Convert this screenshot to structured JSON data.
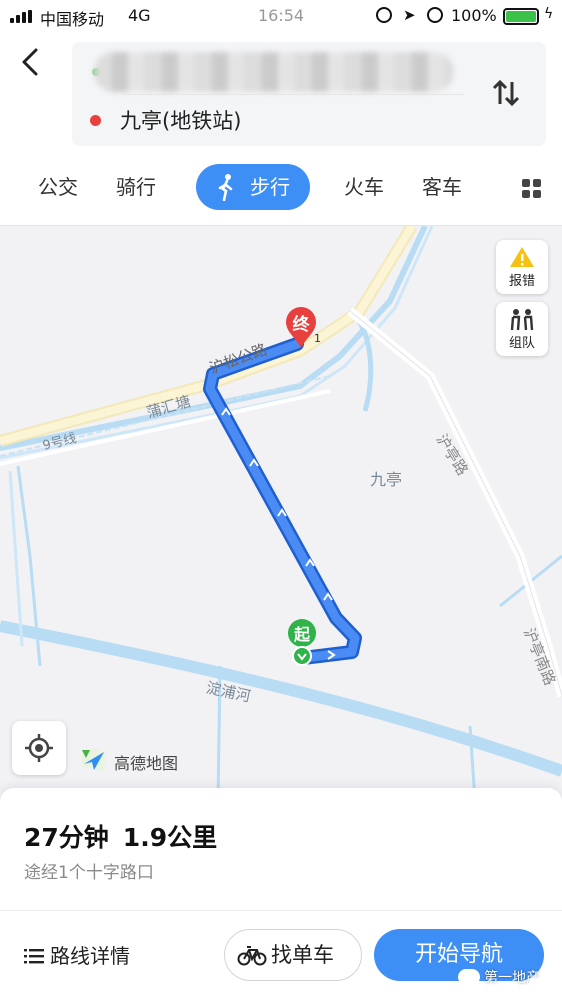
{
  "status_bar": {
    "carrier": "中国移动",
    "network": "4G",
    "time": "16:54",
    "battery": "100%"
  },
  "route": {
    "destination": "九亭(地铁站)"
  },
  "tabs": [
    {
      "label": "公交"
    },
    {
      "label": "骑行"
    },
    {
      "label": "步行",
      "active": true
    },
    {
      "label": "火车"
    },
    {
      "label": "客车"
    }
  ],
  "map": {
    "labels": {
      "road_husong": "沪松公路",
      "river_puhuitang": "蒲汇塘",
      "metro_line9": "9号线",
      "area_jiuting": "九亭",
      "road_huting": "沪亭路",
      "road_huting_south": "沪亭南路",
      "river_dianpu": "淀浦河"
    },
    "start_marker": "起",
    "end_marker": "终",
    "end_index": "1",
    "buttons": {
      "report": "报错",
      "team": "组队"
    },
    "brand": "高德地图"
  },
  "summary": {
    "duration": "27分钟",
    "distance": "1.9公里",
    "via": "途经1个十字路口"
  },
  "actions": {
    "details": "路线详情",
    "find_bike": "找单车",
    "start_nav": "开始导航"
  },
  "watermark": "第一地产",
  "colors": {
    "accent": "#3d8ff6",
    "start_green": "#2fb34a",
    "end_red": "#e8403f",
    "route_blue": "#3d7df0"
  }
}
